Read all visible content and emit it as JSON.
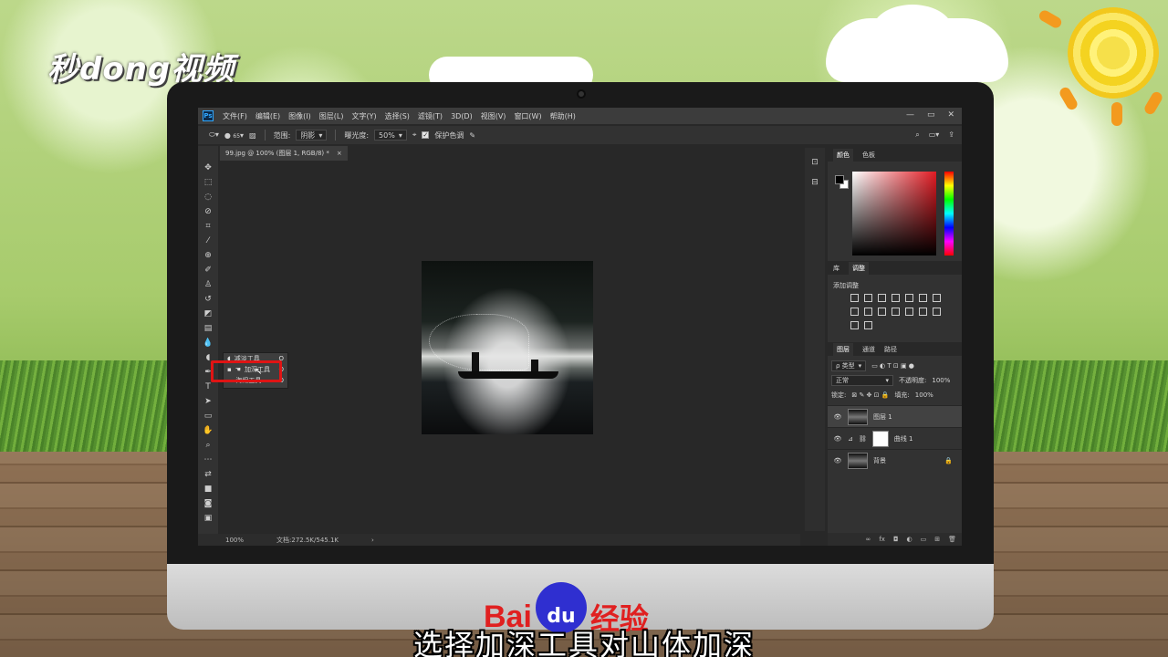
{
  "brand": {
    "channel_logo": "秒dong视频",
    "footer_logo_left": "Bai",
    "footer_logo_mid": "du",
    "footer_logo_right": "经验"
  },
  "subtitle": "选择加深工具对山体加深",
  "colors": {
    "accent_red": "#e01414",
    "ps_blue": "#31a8ff"
  },
  "menubar": {
    "app_icon": "Ps",
    "items": [
      "文件(F)",
      "编辑(E)",
      "图像(I)",
      "图层(L)",
      "文字(Y)",
      "选择(S)",
      "滤镜(T)",
      "3D(D)",
      "视图(V)",
      "窗口(W)",
      "帮助(H)"
    ],
    "window_controls": [
      "—",
      "▭",
      "✕"
    ]
  },
  "options_bar": {
    "brush_size": "65",
    "range_label": "范围:",
    "range_value": "阴影",
    "exposure_label": "曝光度:",
    "exposure_value": "50%",
    "protect_tones_label": "保护色调"
  },
  "document": {
    "tab_title": "99.jpg @ 100% (图层 1, RGB/8) *",
    "close": "×"
  },
  "status": {
    "zoom": "100%",
    "doc_size": "文档:272.5K/545.1K",
    "arrow": "›"
  },
  "tool_flyout": {
    "items": [
      "减淡工具",
      "加深工具",
      "海绵工具"
    ],
    "shortcuts": [
      "O",
      "O",
      "O"
    ]
  },
  "color_panel": {
    "tabs": [
      "颜色",
      "色板"
    ]
  },
  "adjustments_panel": {
    "tabs": [
      "库",
      "调整"
    ],
    "title": "添加调整"
  },
  "layers_panel": {
    "tabs": [
      "图层",
      "通道",
      "路径"
    ],
    "filter": "ρ 类型",
    "blend_mode": "正常",
    "opacity_label": "不透明度:",
    "opacity_value": "100%",
    "lock_label": "锁定:",
    "fill_label": "填充:",
    "fill_value": "100%",
    "layers": [
      {
        "name": "图层 1"
      },
      {
        "name": "曲线 1"
      },
      {
        "name": "背景"
      }
    ],
    "footer_icons": [
      "∞",
      "fx",
      "◘",
      "◐",
      "▭",
      "⊞",
      "🗑"
    ]
  }
}
